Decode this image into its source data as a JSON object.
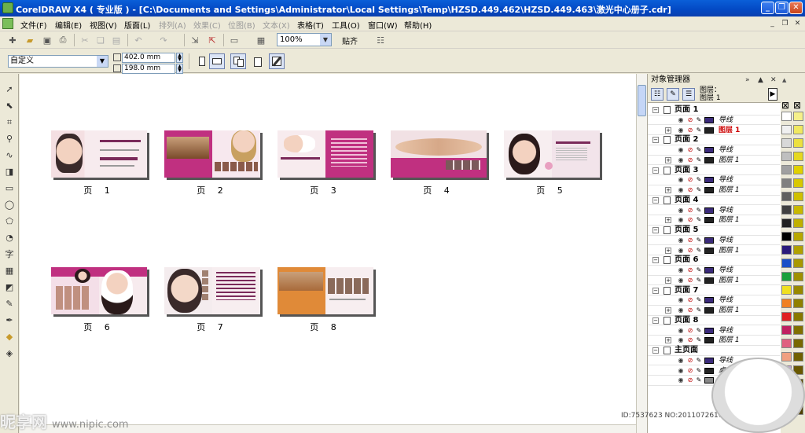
{
  "window": {
    "title": "CorelDRAW X4 ( 专业版 ) - [C:\\Documents and Settings\\Administrator\\Local Settings\\Temp\\HZSD.449.462\\HZSD.449.463\\激光中心册子.cdr]",
    "controls": [
      "_",
      "❐",
      "✕"
    ]
  },
  "menubar": {
    "items": [
      "文件(F)",
      "编辑(E)",
      "视图(V)",
      "版面(L)",
      "排列(A)",
      "效果(C)",
      "位图(B)",
      "文本(X)",
      "表格(T)",
      "工具(O)",
      "窗口(W)",
      "帮助(H)"
    ],
    "doc_controls": [
      "_",
      "❐",
      "✕"
    ]
  },
  "toolbar": {
    "zoom": "100%",
    "snap": "贴齐"
  },
  "propbar": {
    "paper": "自定义",
    "width": "402.0 mm",
    "height": "198.0 mm"
  },
  "pages": [
    {
      "label": "页 1"
    },
    {
      "label": "页 2"
    },
    {
      "label": "页 3"
    },
    {
      "label": "页 4"
    },
    {
      "label": "页 5"
    },
    {
      "label": "页 6"
    },
    {
      "label": "页 7"
    },
    {
      "label": "页 8"
    }
  ],
  "object_manager": {
    "title": "对象管理器",
    "layer_info_line1": "图层：",
    "layer_info_line2": "图层 1",
    "rows": [
      {
        "type": "page",
        "label": "页面 1"
      },
      {
        "type": "layer",
        "label": "导线",
        "color": "#3a2a7a"
      },
      {
        "type": "layer",
        "label": "图层 1",
        "color": "#222222",
        "active": true
      },
      {
        "type": "page",
        "label": "页面 2"
      },
      {
        "type": "layer",
        "label": "导线",
        "color": "#3a2a7a"
      },
      {
        "type": "layer",
        "label": "图层 1",
        "color": "#222222"
      },
      {
        "type": "page",
        "label": "页面 3"
      },
      {
        "type": "layer",
        "label": "导线",
        "color": "#3a2a7a"
      },
      {
        "type": "layer",
        "label": "图层 1",
        "color": "#222222"
      },
      {
        "type": "page",
        "label": "页面 4"
      },
      {
        "type": "layer",
        "label": "导线",
        "color": "#3a2a7a"
      },
      {
        "type": "layer",
        "label": "图层 1",
        "color": "#222222"
      },
      {
        "type": "page",
        "label": "页面 5"
      },
      {
        "type": "layer",
        "label": "导线",
        "color": "#3a2a7a"
      },
      {
        "type": "layer",
        "label": "图层 1",
        "color": "#222222"
      },
      {
        "type": "page",
        "label": "页面 6"
      },
      {
        "type": "layer",
        "label": "导线",
        "color": "#3a2a7a"
      },
      {
        "type": "layer",
        "label": "图层 1",
        "color": "#222222"
      },
      {
        "type": "page",
        "label": "页面 7"
      },
      {
        "type": "layer",
        "label": "导线",
        "color": "#3a2a7a"
      },
      {
        "type": "layer",
        "label": "图层 1",
        "color": "#222222"
      },
      {
        "type": "page",
        "label": "页面 8"
      },
      {
        "type": "layer",
        "label": "导线",
        "color": "#3a2a7a"
      },
      {
        "type": "layer",
        "label": "图层 1",
        "color": "#222222"
      },
      {
        "type": "page",
        "label": "主页面"
      },
      {
        "type": "layer",
        "label": "导线",
        "color": "#3a2a7a"
      },
      {
        "type": "layer",
        "label": "桌面",
        "color": "#222222"
      },
      {
        "type": "layer",
        "label": "网格",
        "color": "#888888"
      }
    ]
  },
  "palette_colors": [
    "#ffffff",
    "#f0f0f0",
    "#d8d8d8",
    "#bfbfbf",
    "#a0a0a0",
    "#808080",
    "#606060",
    "#404040",
    "#202020",
    "#000000",
    "#2a1a7a",
    "#1a4fc8",
    "#1aa03a",
    "#f0e020",
    "#f08020",
    "#e02020",
    "#c02060",
    "#e06080",
    "#f0a080",
    "#c0a0d0",
    "#8070c0",
    "#6a4aa0",
    "#ffe0c0"
  ],
  "palette_yellows": [
    "#f6f08a",
    "#f0e860",
    "#ece040",
    "#e6d820",
    "#e0d000",
    "#d8c800",
    "#d0c000",
    "#c8b800",
    "#c0b000",
    "#b8a800",
    "#b0a000",
    "#a89800",
    "#a09000",
    "#988800",
    "#908000",
    "#887800",
    "#807000",
    "#786800",
    "#706000",
    "#685800",
    "#605000",
    "#584800",
    "#504000"
  ],
  "watermark": {
    "brand": "昵享网",
    "url": "www.nipic.com",
    "id_text": "ID:7537623 NO:20110726103822721200"
  }
}
